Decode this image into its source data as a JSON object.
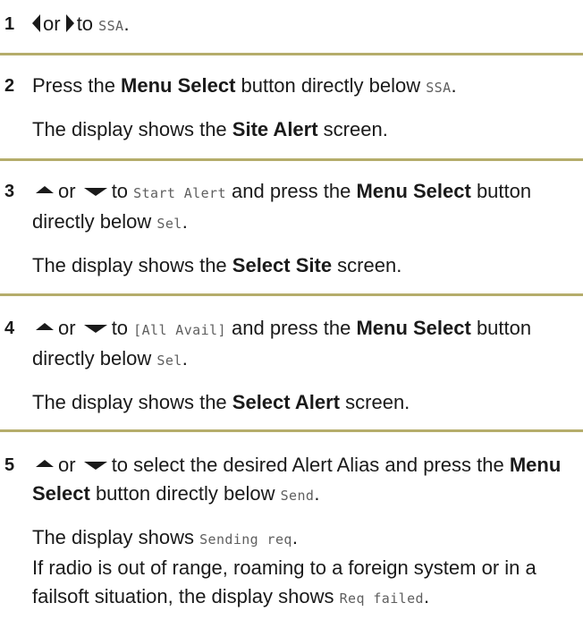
{
  "steps": [
    {
      "number": "1",
      "paras": [
        [
          {
            "icon": "left-arrow-icon"
          },
          {
            "t": "or "
          },
          {
            "icon": "right-arrow-icon"
          },
          {
            "t": "to "
          },
          {
            "m": "SSA"
          },
          {
            "t": "."
          }
        ]
      ]
    },
    {
      "number": "2",
      "paras": [
        [
          {
            "t": "Press the "
          },
          {
            "b": "Menu Select"
          },
          {
            "t": " button directly below "
          },
          {
            "m": "SSA"
          },
          {
            "t": "."
          }
        ],
        [
          {
            "t": "The display shows the "
          },
          {
            "b": "Site Alert"
          },
          {
            "t": " screen."
          }
        ]
      ]
    },
    {
      "number": "3",
      "paras": [
        [
          {
            "icon": "up-arrow-icon"
          },
          {
            "t": "or "
          },
          {
            "icon": "down-arrow-icon"
          },
          {
            "t": "to "
          },
          {
            "m": "Start Alert"
          },
          {
            "t": " and press the "
          },
          {
            "b": "Menu Select"
          },
          {
            "t": " button directly below "
          },
          {
            "m": "Sel"
          },
          {
            "t": "."
          }
        ],
        [
          {
            "t": "The display shows the "
          },
          {
            "b": "Select Site"
          },
          {
            "t": " screen."
          }
        ]
      ]
    },
    {
      "number": "4",
      "paras": [
        [
          {
            "icon": "up-arrow-icon"
          },
          {
            "t": "or "
          },
          {
            "icon": "down-arrow-icon"
          },
          {
            "t": "to "
          },
          {
            "m": "[All Avail]"
          },
          {
            "t": " and press the "
          },
          {
            "b": "Menu Select"
          },
          {
            "t": " button directly below "
          },
          {
            "m": "Sel"
          },
          {
            "t": "."
          }
        ],
        [
          {
            "t": "The display shows the "
          },
          {
            "b": "Select Alert"
          },
          {
            "t": " screen."
          }
        ]
      ]
    },
    {
      "number": "5",
      "paras": [
        [
          {
            "icon": "up-arrow-icon"
          },
          {
            "t": "or "
          },
          {
            "icon": "down-arrow-icon"
          },
          {
            "t": "to select the desired Alert Alias and press the "
          },
          {
            "b": "Menu Select"
          },
          {
            "t": " button directly below "
          },
          {
            "m": "Send"
          },
          {
            "t": "."
          }
        ],
        [
          {
            "t": "The display shows "
          },
          {
            "m": "Sending req"
          },
          {
            "t": "."
          },
          {
            "br": true
          },
          {
            "t": "If radio is out of range, roaming to a foreign system or in a failsoft situation, the display shows "
          },
          {
            "m": "Req failed"
          },
          {
            "t": "."
          }
        ]
      ]
    }
  ],
  "colors": {
    "divider": "#b5ad6b",
    "text": "#1a1a1a",
    "display_text": "#5f5f5f"
  }
}
